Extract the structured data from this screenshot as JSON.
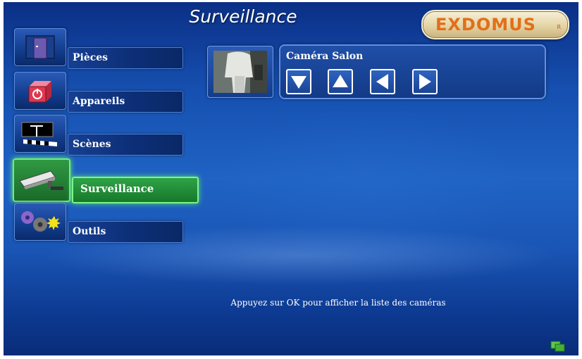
{
  "header": {
    "title": "Surveillance"
  },
  "logo": {
    "text": "EXDOMUS",
    "registered": "R"
  },
  "nav": [
    {
      "id": "pieces",
      "label": "Pièces",
      "icon": "door-icon",
      "active": false
    },
    {
      "id": "appareils",
      "label": "Appareils",
      "icon": "power-box-icon",
      "active": false
    },
    {
      "id": "scenes",
      "label": "Scènes",
      "icon": "clapperboard-icon",
      "active": false
    },
    {
      "id": "surveillance",
      "label": "Surveillance",
      "icon": "security-camera-icon",
      "active": true
    },
    {
      "id": "outils",
      "label": "Outils",
      "icon": "gears-icon",
      "active": false
    }
  ],
  "camera": {
    "name": "Caméra Salon",
    "controls": [
      {
        "name": "pan-down-button",
        "icon": "arrow-down-icon"
      },
      {
        "name": "pan-up-button",
        "icon": "arrow-up-icon"
      },
      {
        "name": "pan-left-button",
        "icon": "arrow-left-icon"
      },
      {
        "name": "pan-right-button",
        "icon": "arrow-right-icon"
      }
    ]
  },
  "hint": "Appuyez sur OK pour afficher la liste des caméras",
  "colors": {
    "accent_active": "#3cc04f",
    "background": "#1a55b5",
    "logo": "#e26f1a"
  }
}
